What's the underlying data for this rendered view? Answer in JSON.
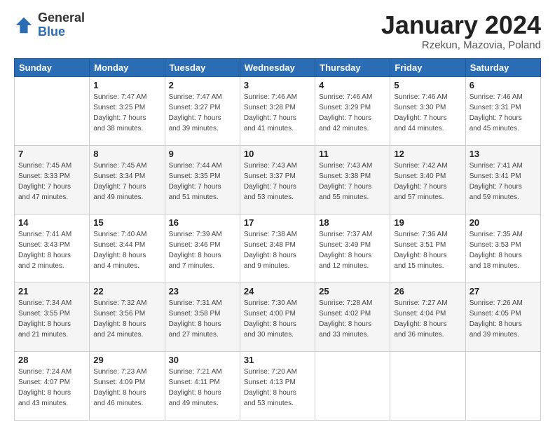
{
  "header": {
    "logo_general": "General",
    "logo_blue": "Blue",
    "title": "January 2024",
    "subtitle": "Rzekun, Mazovia, Poland"
  },
  "weekdays": [
    "Sunday",
    "Monday",
    "Tuesday",
    "Wednesday",
    "Thursday",
    "Friday",
    "Saturday"
  ],
  "weeks": [
    [
      {
        "day": "",
        "info": ""
      },
      {
        "day": "1",
        "info": "Sunrise: 7:47 AM\nSunset: 3:25 PM\nDaylight: 7 hours\nand 38 minutes."
      },
      {
        "day": "2",
        "info": "Sunrise: 7:47 AM\nSunset: 3:27 PM\nDaylight: 7 hours\nand 39 minutes."
      },
      {
        "day": "3",
        "info": "Sunrise: 7:46 AM\nSunset: 3:28 PM\nDaylight: 7 hours\nand 41 minutes."
      },
      {
        "day": "4",
        "info": "Sunrise: 7:46 AM\nSunset: 3:29 PM\nDaylight: 7 hours\nand 42 minutes."
      },
      {
        "day": "5",
        "info": "Sunrise: 7:46 AM\nSunset: 3:30 PM\nDaylight: 7 hours\nand 44 minutes."
      },
      {
        "day": "6",
        "info": "Sunrise: 7:46 AM\nSunset: 3:31 PM\nDaylight: 7 hours\nand 45 minutes."
      }
    ],
    [
      {
        "day": "7",
        "info": "Sunrise: 7:45 AM\nSunset: 3:33 PM\nDaylight: 7 hours\nand 47 minutes."
      },
      {
        "day": "8",
        "info": "Sunrise: 7:45 AM\nSunset: 3:34 PM\nDaylight: 7 hours\nand 49 minutes."
      },
      {
        "day": "9",
        "info": "Sunrise: 7:44 AM\nSunset: 3:35 PM\nDaylight: 7 hours\nand 51 minutes."
      },
      {
        "day": "10",
        "info": "Sunrise: 7:43 AM\nSunset: 3:37 PM\nDaylight: 7 hours\nand 53 minutes."
      },
      {
        "day": "11",
        "info": "Sunrise: 7:43 AM\nSunset: 3:38 PM\nDaylight: 7 hours\nand 55 minutes."
      },
      {
        "day": "12",
        "info": "Sunrise: 7:42 AM\nSunset: 3:40 PM\nDaylight: 7 hours\nand 57 minutes."
      },
      {
        "day": "13",
        "info": "Sunrise: 7:41 AM\nSunset: 3:41 PM\nDaylight: 7 hours\nand 59 minutes."
      }
    ],
    [
      {
        "day": "14",
        "info": "Sunrise: 7:41 AM\nSunset: 3:43 PM\nDaylight: 8 hours\nand 2 minutes."
      },
      {
        "day": "15",
        "info": "Sunrise: 7:40 AM\nSunset: 3:44 PM\nDaylight: 8 hours\nand 4 minutes."
      },
      {
        "day": "16",
        "info": "Sunrise: 7:39 AM\nSunset: 3:46 PM\nDaylight: 8 hours\nand 7 minutes."
      },
      {
        "day": "17",
        "info": "Sunrise: 7:38 AM\nSunset: 3:48 PM\nDaylight: 8 hours\nand 9 minutes."
      },
      {
        "day": "18",
        "info": "Sunrise: 7:37 AM\nSunset: 3:49 PM\nDaylight: 8 hours\nand 12 minutes."
      },
      {
        "day": "19",
        "info": "Sunrise: 7:36 AM\nSunset: 3:51 PM\nDaylight: 8 hours\nand 15 minutes."
      },
      {
        "day": "20",
        "info": "Sunrise: 7:35 AM\nSunset: 3:53 PM\nDaylight: 8 hours\nand 18 minutes."
      }
    ],
    [
      {
        "day": "21",
        "info": "Sunrise: 7:34 AM\nSunset: 3:55 PM\nDaylight: 8 hours\nand 21 minutes."
      },
      {
        "day": "22",
        "info": "Sunrise: 7:32 AM\nSunset: 3:56 PM\nDaylight: 8 hours\nand 24 minutes."
      },
      {
        "day": "23",
        "info": "Sunrise: 7:31 AM\nSunset: 3:58 PM\nDaylight: 8 hours\nand 27 minutes."
      },
      {
        "day": "24",
        "info": "Sunrise: 7:30 AM\nSunset: 4:00 PM\nDaylight: 8 hours\nand 30 minutes."
      },
      {
        "day": "25",
        "info": "Sunrise: 7:28 AM\nSunset: 4:02 PM\nDaylight: 8 hours\nand 33 minutes."
      },
      {
        "day": "26",
        "info": "Sunrise: 7:27 AM\nSunset: 4:04 PM\nDaylight: 8 hours\nand 36 minutes."
      },
      {
        "day": "27",
        "info": "Sunrise: 7:26 AM\nSunset: 4:05 PM\nDaylight: 8 hours\nand 39 minutes."
      }
    ],
    [
      {
        "day": "28",
        "info": "Sunrise: 7:24 AM\nSunset: 4:07 PM\nDaylight: 8 hours\nand 43 minutes."
      },
      {
        "day": "29",
        "info": "Sunrise: 7:23 AM\nSunset: 4:09 PM\nDaylight: 8 hours\nand 46 minutes."
      },
      {
        "day": "30",
        "info": "Sunrise: 7:21 AM\nSunset: 4:11 PM\nDaylight: 8 hours\nand 49 minutes."
      },
      {
        "day": "31",
        "info": "Sunrise: 7:20 AM\nSunset: 4:13 PM\nDaylight: 8 hours\nand 53 minutes."
      },
      {
        "day": "",
        "info": ""
      },
      {
        "day": "",
        "info": ""
      },
      {
        "day": "",
        "info": ""
      }
    ]
  ]
}
